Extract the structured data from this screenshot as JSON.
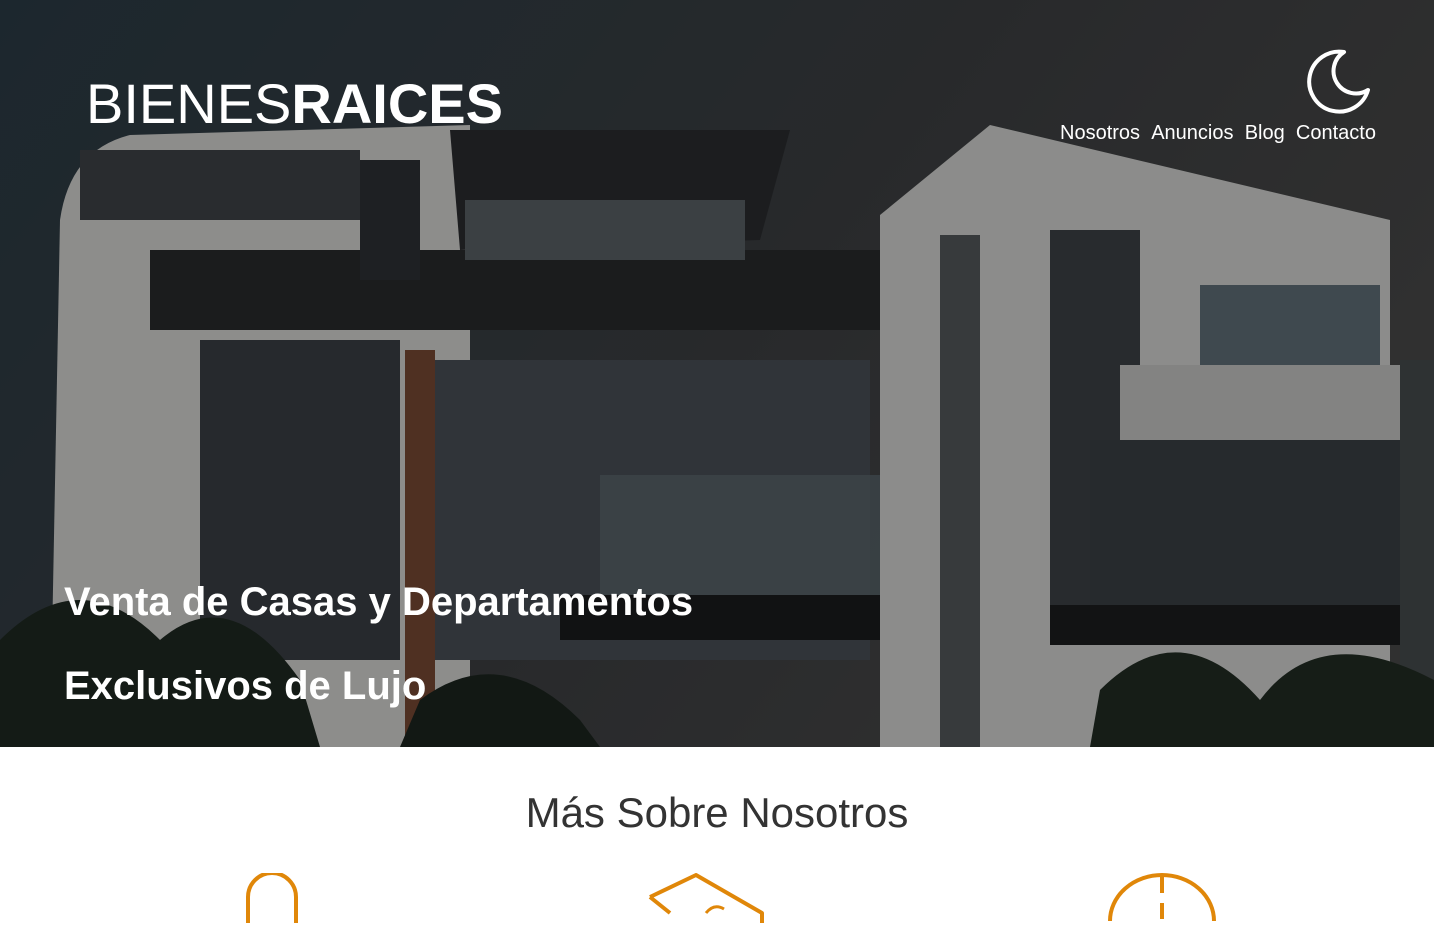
{
  "header": {
    "logo_light": "BIENES",
    "logo_bold": "RAICES",
    "theme_toggle_icon": "moon-icon",
    "nav": [
      {
        "label": "Nosotros"
      },
      {
        "label": "Anuncios"
      },
      {
        "label": "Blog"
      },
      {
        "label": "Contacto"
      }
    ]
  },
  "hero": {
    "title_line1": "Venta de Casas y Departamentos",
    "title_line2": "Exclusivos de Lujo"
  },
  "about": {
    "title": "Más Sobre Nosotros",
    "feature_icons": [
      "security-icon",
      "price-tag-icon",
      "clock-icon"
    ],
    "accent_color": "#E08709"
  }
}
